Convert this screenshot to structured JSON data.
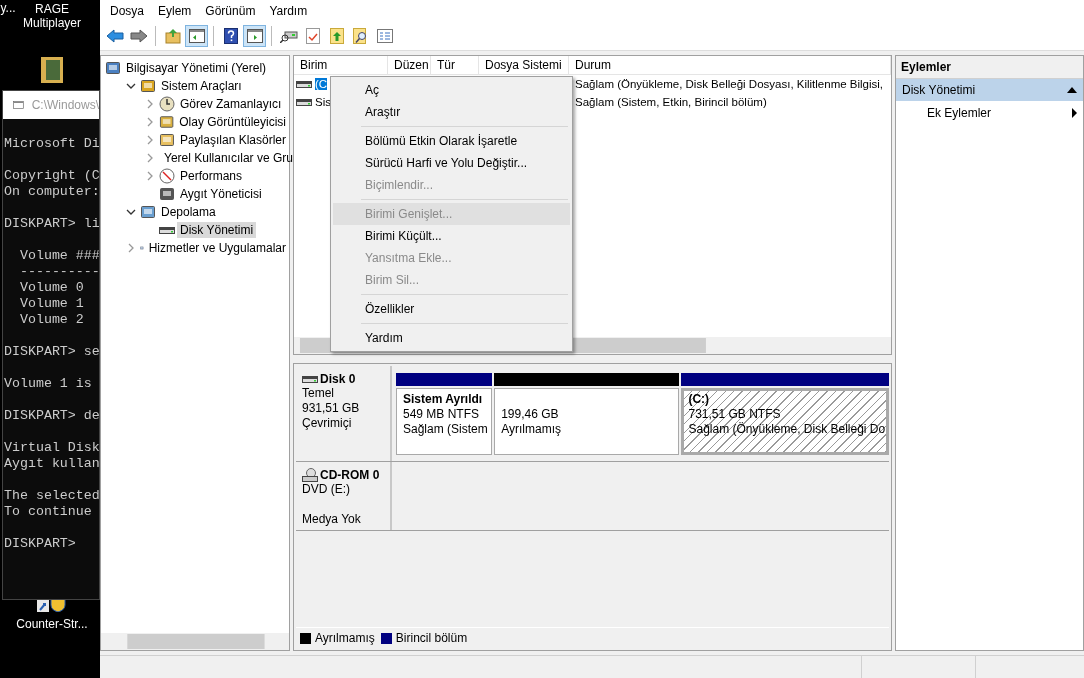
{
  "desktop": {
    "icons": [
      {
        "kind": "cut",
        "label": "y..."
      },
      {
        "kind": "app",
        "label": "RAGE\nMultiplayer"
      },
      {
        "kind": "folder"
      },
      {
        "kind": "shortcut",
        "label": "Counter-Str..."
      }
    ],
    "console": {
      "title": "C:\\Windows\\",
      "blocks": [
        {
          "lines": [
            "Microsoft Di"
          ]
        },
        {
          "lines": [
            "Copyright (C",
            "On computer:"
          ]
        },
        {
          "lines": [
            "DISKPART> li"
          ]
        },
        {
          "lines": [
            "  Volume ###",
            "  ----------",
            "  Volume 0",
            "  Volume 1",
            "  Volume 2"
          ]
        },
        {
          "lines": [
            "DISKPART> se"
          ]
        },
        {
          "lines": [
            "Volume 1 is"
          ]
        },
        {
          "lines": [
            "DISKPART> de"
          ]
        },
        {
          "lines": [
            "Virtual Disk",
            "Aygıt kullan"
          ]
        },
        {
          "lines": [
            "The selected",
            "To continue"
          ]
        },
        {
          "lines": [
            "DISKPART>"
          ]
        }
      ]
    }
  },
  "menu": [
    "Dosya",
    "Eylem",
    "Görünüm",
    "Yardım"
  ],
  "toolbar": [
    {
      "kind": "back",
      "on": false
    },
    {
      "kind": "forward",
      "on": false
    },
    {
      "kind": "sep"
    },
    {
      "kind": "up",
      "on": false
    },
    {
      "kind": "tree",
      "on": true
    },
    {
      "kind": "sep"
    },
    {
      "kind": "help",
      "on": false
    },
    {
      "kind": "actions",
      "on": true
    },
    {
      "kind": "sep"
    },
    {
      "kind": "connect",
      "on": false
    },
    {
      "kind": "check",
      "on": false
    },
    {
      "kind": "export",
      "on": false
    },
    {
      "kind": "find",
      "on": false
    },
    {
      "kind": "list",
      "on": false
    }
  ],
  "tree": [
    {
      "label": "Bilgisayar Yönetimi (Yerel)",
      "selected": false,
      "children": [
        {
          "label": "Sistem Araçları",
          "expanded": true,
          "selected": false,
          "children": [
            {
              "label": "Görev Zamanlayıcı",
              "expanded": false,
              "selected": false
            },
            {
              "label": "Olay Görüntüleyicisi",
              "expanded": false,
              "selected": false
            },
            {
              "label": "Paylaşılan Klasörler",
              "expanded": false,
              "selected": false
            },
            {
              "label": "Yerel Kullanıcılar ve Gru",
              "expanded": false,
              "selected": false
            },
            {
              "label": "Performans",
              "expanded": false,
              "selected": false
            },
            {
              "label": "Aygıt Yöneticisi",
              "selected": false
            }
          ]
        },
        {
          "label": "Depolama",
          "expanded": true,
          "selected": false,
          "children": [
            {
              "label": "Disk Yönetimi",
              "selected": true
            }
          ]
        },
        {
          "label": "Hizmetler ve Uygulamalar",
          "expanded": false,
          "selected": false
        }
      ]
    }
  ],
  "table": {
    "columns": [
      "Birim",
      "Düzen",
      "Tür",
      "Dosya Sistemi",
      "Durum"
    ],
    "rows": [
      {
        "selected": true,
        "cells": [
          "(C",
          "",
          "",
          "",
          "Sağlam (Önyükleme, Disk Belleği Dosyası, Kilitlenme Bilgisi,"
        ]
      },
      {
        "selected": false,
        "cells": [
          "Sis",
          "",
          "",
          "",
          "Sağlam (Sistem, Etkin, Birincil bölüm)"
        ]
      }
    ]
  },
  "context_menu": [
    {
      "kind": "item",
      "label": "Aç",
      "disabled": false,
      "selected": false
    },
    {
      "kind": "item",
      "label": "Araştır",
      "disabled": false,
      "selected": false
    },
    {
      "kind": "separator"
    },
    {
      "kind": "item",
      "label": "Bölümü Etkin Olarak İşaretle",
      "disabled": false,
      "selected": false
    },
    {
      "kind": "item",
      "label": "Sürücü Harfi ve Yolu Değiştir...",
      "disabled": false,
      "selected": false
    },
    {
      "kind": "item",
      "label": "Biçimlendir...",
      "disabled": true,
      "selected": false
    },
    {
      "kind": "separator"
    },
    {
      "kind": "item",
      "label": "Birimi Genişlet...",
      "disabled": true,
      "selected": true
    },
    {
      "kind": "item",
      "label": "Birimi Küçült...",
      "disabled": false,
      "selected": false
    },
    {
      "kind": "item",
      "label": "Yansıtma Ekle...",
      "disabled": true,
      "selected": false
    },
    {
      "kind": "item",
      "label": "Birim Sil...",
      "disabled": true,
      "selected": false
    },
    {
      "kind": "separator"
    },
    {
      "kind": "item",
      "label": "Özellikler",
      "disabled": false,
      "selected": false
    },
    {
      "kind": "separator"
    },
    {
      "kind": "item",
      "label": "Yardım",
      "disabled": false,
      "selected": false
    }
  ],
  "disks": [
    {
      "kind": "disk",
      "name": "Disk 0",
      "lines": [
        "Temel",
        "931,51 GB",
        "Çevrimiçi"
      ],
      "partitions": [
        {
          "title": "Sistem Ayrıldı",
          "lines": [
            "549 MB NTFS",
            "Sağlam (Sistem"
          ],
          "color": "#000080",
          "selected": false
        },
        {
          "lines": [
            "199,46 GB",
            "Ayrılmamış"
          ],
          "color": "#000000",
          "selected": false
        },
        {
          "title": "(C:)",
          "lines": [
            "731,51 GB NTFS",
            "Sağlam (Önyükleme, Disk Belleği Do"
          ],
          "color": "#000080",
          "selected": true
        }
      ]
    },
    {
      "kind": "cdrom",
      "name": "CD-ROM 0",
      "lines": [
        "DVD (E:)",
        "Medya Yok"
      ]
    }
  ],
  "legend": [
    {
      "label": "Ayrılmamış",
      "color": "#000000"
    },
    {
      "label": "Birincil bölüm",
      "color": "#000080"
    }
  ],
  "actions": {
    "title": "Eylemler",
    "sections": [
      {
        "label": "Disk Yönetimi",
        "expanded": true,
        "items": [
          "Ek Eylemler"
        ]
      }
    ]
  }
}
